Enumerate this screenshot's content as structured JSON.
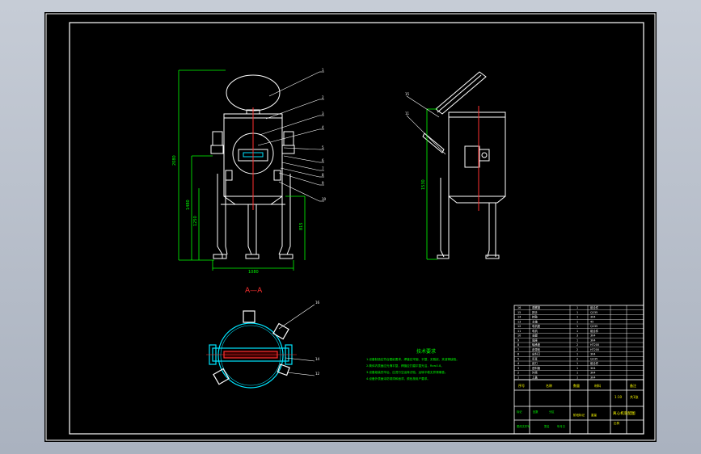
{
  "colors": {
    "background": "#000000",
    "outline": "#ffffff",
    "dimension": "#00ff00",
    "centerline": "#ff3030",
    "section": "#00e5ff",
    "leader": "#ffffff",
    "frame_bg": "#b9c0cc"
  },
  "section_label": "A—A",
  "dim_labels": {
    "total_height": "2080",
    "body_height": "1480",
    "leg_height": "1250",
    "mid_height": "815",
    "width": "1080",
    "side_height": "1530"
  },
  "front_part_numbers": [
    "1",
    "2",
    "3",
    "4",
    "5",
    "6",
    "7",
    "8",
    "9",
    "10"
  ],
  "side_part_numbers": [
    "15",
    "11"
  ],
  "plan_part_numbers": [
    "16",
    "14",
    "12"
  ],
  "notes": {
    "heading": "技术要求",
    "lines": [
      "1.设备制造应符合图纸要求，焊缝应牢固、平整，无裂纹、夹渣等缺陷。",
      "2.筒体内表面应光滑平整，焊缝应打磨平整光洁，Ra≤0.8。",
      "3.设备组装完毕后，应进行空运转试验，运转平稳无异常噪音。",
      "4.设备外表面涂防锈漆和面漆，颜色按用户要求。"
    ]
  },
  "title_block": {
    "drawing_title": "离心机装配图",
    "header_row": [
      "序号",
      "名称",
      "数量",
      "材料",
      "备注"
    ],
    "scale": "1:10",
    "sheet": "共1张",
    "bottom_row": [
      "标记",
      "处数",
      "分区",
      "更改文件号",
      "签名",
      "年月日"
    ],
    "stage_labels": [
      "阶段标记",
      "重量",
      "比例"
    ]
  },
  "bom_rows": [
    {
      "no": "16",
      "name": "观察窗",
      "qty": "1",
      "mat": "组合件"
    },
    {
      "no": "15",
      "name": "把手",
      "qty": "1",
      "mat": "Q235"
    },
    {
      "no": "14",
      "name": "转鼓",
      "qty": "1",
      "mat": "304"
    },
    {
      "no": "13",
      "name": "主轴",
      "qty": "1",
      "mat": "45"
    },
    {
      "no": "12",
      "name": "电机座",
      "qty": "1",
      "mat": "Q235"
    },
    {
      "no": "11",
      "name": "电机",
      "qty": "1",
      "mat": "组合件"
    },
    {
      "no": "10",
      "name": "支腿",
      "qty": "3",
      "mat": "304"
    },
    {
      "no": "9",
      "name": "底座",
      "qty": "1",
      "mat": "304"
    },
    {
      "no": "8",
      "name": "轴承座",
      "qty": "2",
      "mat": "HT200"
    },
    {
      "no": "7",
      "name": "皮带轮",
      "qty": "2",
      "mat": "HT200"
    },
    {
      "no": "6",
      "name": "出料口",
      "qty": "1",
      "mat": "304"
    },
    {
      "no": "5",
      "name": "吊耳",
      "qty": "2",
      "mat": "Q235"
    },
    {
      "no": "4",
      "name": "刮刀",
      "qty": "1",
      "mat": "组合件"
    },
    {
      "no": "3",
      "name": "进料管",
      "qty": "1",
      "mat": "304"
    },
    {
      "no": "2",
      "name": "外壳",
      "qty": "1",
      "mat": "304"
    },
    {
      "no": "1",
      "name": "上盖",
      "qty": "1",
      "mat": "304"
    }
  ]
}
